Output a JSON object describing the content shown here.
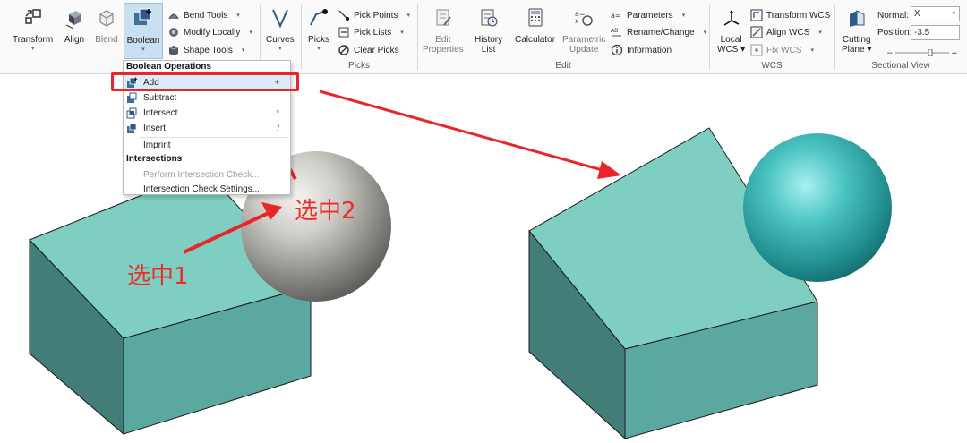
{
  "ribbon": {
    "transform": "Transform",
    "align": "Align",
    "blend": "Blend",
    "boolean": "Boolean",
    "bend_tools": "Bend Tools",
    "modify_locally": "Modify Locally",
    "shape_tools": "Shape Tools",
    "curves": "Curves",
    "picks": "Picks",
    "pick_points": "Pick Points",
    "pick_lists": "Pick Lists",
    "clear_picks": "Clear Picks",
    "picks_group": "Picks",
    "edit_properties_1": "Edit",
    "edit_properties_2": "Properties",
    "history_1": "History",
    "history_2": "List",
    "calculator": "Calculator",
    "parametric_1": "Parametric",
    "parametric_2": "Update",
    "parameters": "Parameters",
    "rename_change": "Rename/Change",
    "information": "Information",
    "edit_group": "Edit",
    "local_wcs_1": "Local",
    "local_wcs_2": "WCS",
    "transform_wcs": "Transform WCS",
    "align_wcs": "Align WCS",
    "fix_wcs": "Fix WCS",
    "wcs_group": "WCS",
    "cutting_plane_1": "Cutting",
    "cutting_plane_2": "Plane",
    "normal_label": "Normal:",
    "normal_value": "X",
    "position_label": "Position:",
    "position_value": "-3.5",
    "sectional_group": "Sectional View"
  },
  "menu": {
    "boolean_ops_header": "Boolean Operations",
    "items": [
      {
        "label": "Add",
        "shortcut": "+"
      },
      {
        "label": "Subtract",
        "shortcut": "-"
      },
      {
        "label": "Intersect",
        "shortcut": "*"
      },
      {
        "label": "Insert",
        "shortcut": "/"
      }
    ],
    "imprint": "Imprint",
    "intersections_header": "Intersections",
    "perform_check": "Perform Intersection Check...",
    "check_settings": "Intersection Check Settings..."
  },
  "annotations": {
    "select1": "选中1",
    "select2": "选中2"
  },
  "colors": {
    "accent_red": "#e8262a",
    "box_top": "#7ecfc1",
    "box_front": "#5ba8a0",
    "box_side": "#427d78"
  }
}
